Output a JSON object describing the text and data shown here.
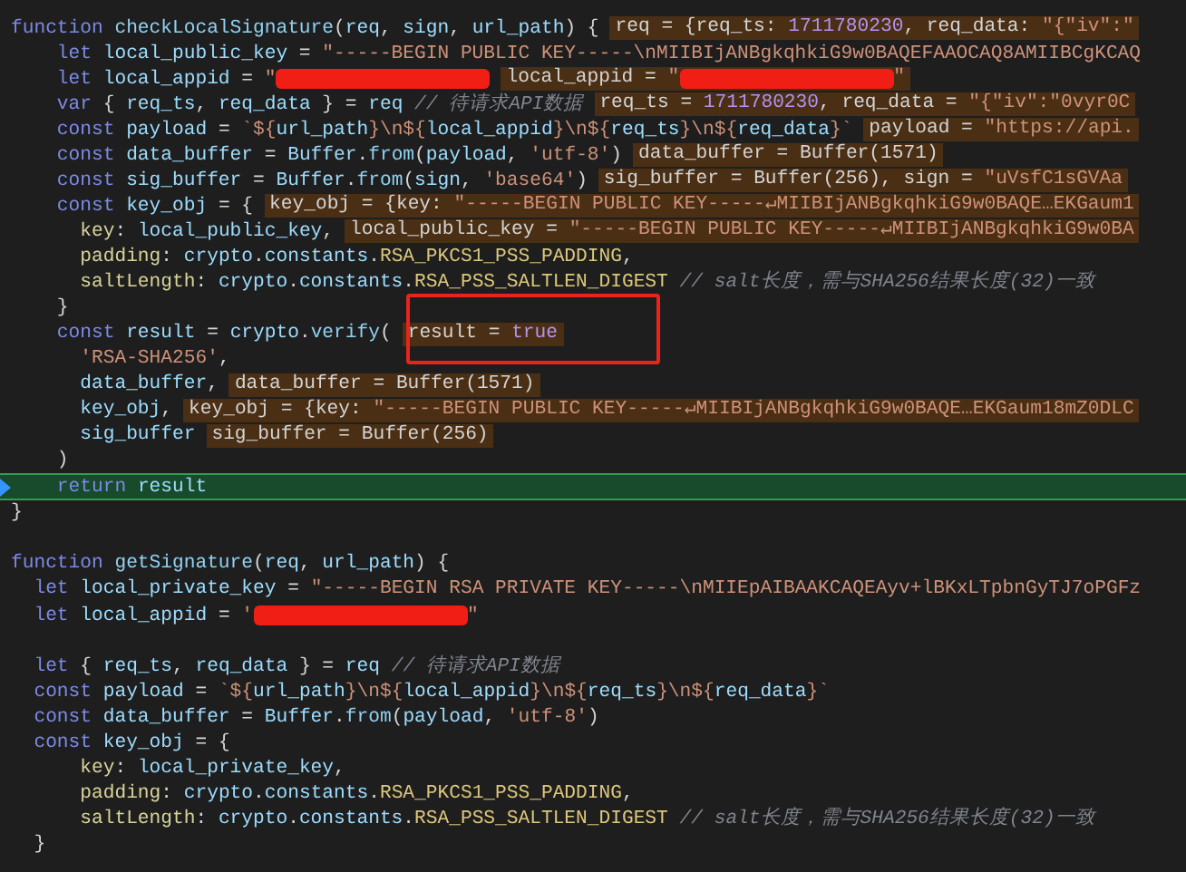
{
  "editor": {
    "lines": [
      {
        "kind": "code",
        "segs": [
          {
            "kind": "kw",
            "text": "function "
          },
          {
            "kind": "fn",
            "text": "checkLocalSignature"
          },
          {
            "kind": "plain",
            "text": "("
          },
          {
            "kind": "var",
            "text": "req"
          },
          {
            "kind": "plain",
            "text": ", "
          },
          {
            "kind": "var",
            "text": "sign"
          },
          {
            "kind": "plain",
            "text": ", "
          },
          {
            "kind": "var",
            "text": "url_path"
          },
          {
            "kind": "plain",
            "text": ") {"
          }
        ],
        "hint": [
          {
            "kind": "plain",
            "text": "req = {req_ts: "
          },
          {
            "kind": "num",
            "text": "1711780230"
          },
          {
            "kind": "plain",
            "text": ", req_data: "
          },
          {
            "kind": "str",
            "text": "\"{\"iv\":\""
          }
        ]
      },
      {
        "kind": "code",
        "segs": [
          {
            "kind": "kw",
            "text": "    let "
          },
          {
            "kind": "var",
            "text": "local_public_key"
          },
          {
            "kind": "plain",
            "text": " = "
          },
          {
            "kind": "str",
            "text": "\"-----BEGIN PUBLIC KEY-----\\nMIIBIjANBgkqhkiG9w0BAQEFAAOCAQ8AMIIBCgKCAQ"
          }
        ]
      },
      {
        "kind": "code",
        "segs": [
          {
            "kind": "kw",
            "text": "    let "
          },
          {
            "kind": "var",
            "text": "local_appid"
          },
          {
            "kind": "plain",
            "text": " = "
          },
          {
            "kind": "str",
            "text": "\""
          },
          {
            "kind": "redact"
          }
        ],
        "hint": [
          {
            "kind": "plain",
            "text": "local_appid = "
          },
          {
            "kind": "str",
            "text": "\""
          },
          {
            "kind": "redact"
          },
          {
            "kind": "str",
            "text": "\""
          }
        ]
      },
      {
        "kind": "code",
        "segs": [
          {
            "kind": "kw",
            "text": "    var "
          },
          {
            "kind": "plain",
            "text": "{ "
          },
          {
            "kind": "var",
            "text": "req_ts"
          },
          {
            "kind": "plain",
            "text": ", "
          },
          {
            "kind": "var",
            "text": "req_data"
          },
          {
            "kind": "plain",
            "text": " } = "
          },
          {
            "kind": "var",
            "text": "req"
          },
          {
            "kind": "cmt",
            "text": " // 待请求API数据"
          }
        ],
        "hint": [
          {
            "kind": "plain",
            "text": "req_ts = "
          },
          {
            "kind": "num",
            "text": "1711780230"
          },
          {
            "kind": "plain",
            "text": ", req_data = "
          },
          {
            "kind": "str",
            "text": "\"{\"iv\":\"0vyr0C"
          }
        ]
      },
      {
        "kind": "code",
        "segs": [
          {
            "kind": "kw",
            "text": "    const "
          },
          {
            "kind": "var",
            "text": "payload"
          },
          {
            "kind": "plain",
            "text": " = "
          },
          {
            "kind": "str",
            "text": "`${"
          },
          {
            "kind": "var",
            "text": "url_path"
          },
          {
            "kind": "str",
            "text": "}\\n${"
          },
          {
            "kind": "var",
            "text": "local_appid"
          },
          {
            "kind": "str",
            "text": "}\\n${"
          },
          {
            "kind": "var",
            "text": "req_ts"
          },
          {
            "kind": "str",
            "text": "}\\n${"
          },
          {
            "kind": "var",
            "text": "req_data"
          },
          {
            "kind": "str",
            "text": "}`"
          }
        ],
        "hint": [
          {
            "kind": "plain",
            "text": "payload = "
          },
          {
            "kind": "str",
            "text": "\"https://api."
          }
        ]
      },
      {
        "kind": "code",
        "segs": [
          {
            "kind": "kw",
            "text": "    const "
          },
          {
            "kind": "var",
            "text": "data_buffer"
          },
          {
            "kind": "plain",
            "text": " = "
          },
          {
            "kind": "var",
            "text": "Buffer"
          },
          {
            "kind": "plain",
            "text": "."
          },
          {
            "kind": "fn",
            "text": "from"
          },
          {
            "kind": "plain",
            "text": "("
          },
          {
            "kind": "var",
            "text": "payload"
          },
          {
            "kind": "plain",
            "text": ", "
          },
          {
            "kind": "str",
            "text": "'utf-8'"
          },
          {
            "kind": "plain",
            "text": ")"
          }
        ],
        "hint": [
          {
            "kind": "plain",
            "text": "data_buffer = Buffer(1571)"
          }
        ]
      },
      {
        "kind": "code",
        "segs": [
          {
            "kind": "kw",
            "text": "    const "
          },
          {
            "kind": "var",
            "text": "sig_buffer"
          },
          {
            "kind": "plain",
            "text": " = "
          },
          {
            "kind": "var",
            "text": "Buffer"
          },
          {
            "kind": "plain",
            "text": "."
          },
          {
            "kind": "fn",
            "text": "from"
          },
          {
            "kind": "plain",
            "text": "("
          },
          {
            "kind": "var",
            "text": "sign"
          },
          {
            "kind": "plain",
            "text": ", "
          },
          {
            "kind": "str",
            "text": "'base64'"
          },
          {
            "kind": "plain",
            "text": ")"
          }
        ],
        "hint": [
          {
            "kind": "plain",
            "text": "sig_buffer = Buffer(256), sign = "
          },
          {
            "kind": "str",
            "text": "\"uVsfC1sGVAa"
          }
        ]
      },
      {
        "kind": "code",
        "segs": [
          {
            "kind": "kw",
            "text": "    const "
          },
          {
            "kind": "var",
            "text": "key_obj"
          },
          {
            "kind": "plain",
            "text": " = {"
          }
        ],
        "hint": [
          {
            "kind": "plain",
            "text": "key_obj = {key: "
          },
          {
            "kind": "str",
            "text": "\"-----BEGIN PUBLIC KEY-----↵MIIBIjANBgkqhkiG9w0BAQE…EKGaum1"
          }
        ]
      },
      {
        "kind": "code",
        "segs": [
          {
            "kind": "prop",
            "text": "      key"
          },
          {
            "kind": "plain",
            "text": ": "
          },
          {
            "kind": "var",
            "text": "local_public_key"
          },
          {
            "kind": "plain",
            "text": ","
          }
        ],
        "hint": [
          {
            "kind": "plain",
            "text": "local_public_key = "
          },
          {
            "kind": "str",
            "text": "\"-----BEGIN PUBLIC KEY-----↵MIIBIjANBgkqhkiG9w0BA"
          }
        ]
      },
      {
        "kind": "code",
        "segs": [
          {
            "kind": "prop",
            "text": "      padding"
          },
          {
            "kind": "plain",
            "text": ": "
          },
          {
            "kind": "var",
            "text": "crypto"
          },
          {
            "kind": "plain",
            "text": "."
          },
          {
            "kind": "var",
            "text": "constants"
          },
          {
            "kind": "plain",
            "text": "."
          },
          {
            "kind": "const",
            "text": "RSA_PKCS1_PSS_PADDING"
          },
          {
            "kind": "plain",
            "text": ","
          }
        ]
      },
      {
        "kind": "code",
        "segs": [
          {
            "kind": "prop",
            "text": "      saltLength"
          },
          {
            "kind": "plain",
            "text": ": "
          },
          {
            "kind": "var",
            "text": "crypto"
          },
          {
            "kind": "plain",
            "text": "."
          },
          {
            "kind": "var",
            "text": "constants"
          },
          {
            "kind": "plain",
            "text": "."
          },
          {
            "kind": "const",
            "text": "RSA_PSS_SALTLEN_DIGEST"
          },
          {
            "kind": "cmt",
            "text": " // salt长度，需与SHA256结果长度(32)一致"
          }
        ]
      },
      {
        "kind": "code",
        "segs": [
          {
            "kind": "plain",
            "text": "    }"
          }
        ]
      },
      {
        "kind": "code",
        "segs": [
          {
            "kind": "kw",
            "text": "    const "
          },
          {
            "kind": "var",
            "text": "result"
          },
          {
            "kind": "plain",
            "text": " = "
          },
          {
            "kind": "var",
            "text": "crypto"
          },
          {
            "kind": "plain",
            "text": "."
          },
          {
            "kind": "fn",
            "text": "verify"
          },
          {
            "kind": "plain",
            "text": "("
          }
        ],
        "hint": [
          {
            "kind": "plain",
            "text": "result = "
          },
          {
            "kind": "num",
            "text": "true"
          }
        ]
      },
      {
        "kind": "code",
        "segs": [
          {
            "kind": "str",
            "text": "      'RSA-SHA256'"
          },
          {
            "kind": "plain",
            "text": ","
          }
        ]
      },
      {
        "kind": "code",
        "segs": [
          {
            "kind": "var",
            "text": "      data_buffer"
          },
          {
            "kind": "plain",
            "text": ","
          }
        ],
        "hint": [
          {
            "kind": "plain",
            "text": "data_buffer = Buffer(1571)"
          }
        ]
      },
      {
        "kind": "code",
        "segs": [
          {
            "kind": "var",
            "text": "      key_obj"
          },
          {
            "kind": "plain",
            "text": ","
          }
        ],
        "hint": [
          {
            "kind": "plain",
            "text": "key_obj = {key: "
          },
          {
            "kind": "str",
            "text": "\"-----BEGIN PUBLIC KEY-----↵MIIBIjANBgkqhkiG9w0BAQE…EKGaum18mZ0DLC"
          }
        ]
      },
      {
        "kind": "code",
        "segs": [
          {
            "kind": "var",
            "text": "      sig_buffer"
          }
        ],
        "hint": [
          {
            "kind": "plain",
            "text": "sig_buffer = Buffer(256)"
          }
        ]
      },
      {
        "kind": "code",
        "segs": [
          {
            "kind": "plain",
            "text": "    )"
          }
        ]
      },
      {
        "kind": "code",
        "current": true,
        "segs": [
          {
            "kind": "kw",
            "text": "    return "
          },
          {
            "kind": "var",
            "text": "result"
          }
        ]
      },
      {
        "kind": "code",
        "segs": [
          {
            "kind": "plain",
            "text": "}"
          }
        ]
      },
      {
        "kind": "blank"
      },
      {
        "kind": "code",
        "segs": [
          {
            "kind": "kw",
            "text": "function "
          },
          {
            "kind": "fn",
            "text": "getSignature"
          },
          {
            "kind": "plain",
            "text": "("
          },
          {
            "kind": "var",
            "text": "req"
          },
          {
            "kind": "plain",
            "text": ", "
          },
          {
            "kind": "var",
            "text": "url_path"
          },
          {
            "kind": "plain",
            "text": ") {"
          }
        ]
      },
      {
        "kind": "code",
        "segs": [
          {
            "kind": "kw",
            "text": "  let "
          },
          {
            "kind": "var",
            "text": "local_private_key"
          },
          {
            "kind": "plain",
            "text": " = "
          },
          {
            "kind": "str",
            "text": "\"-----BEGIN RSA PRIVATE KEY-----\\nMIIEpAIBAAKCAQEAyv+lBKxLTpbnGyTJ7oPGFz"
          }
        ]
      },
      {
        "kind": "code",
        "segs": [
          {
            "kind": "kw",
            "text": "  let "
          },
          {
            "kind": "var",
            "text": "local_appid"
          },
          {
            "kind": "plain",
            "text": " = "
          },
          {
            "kind": "str",
            "text": "'"
          },
          {
            "kind": "redact"
          },
          {
            "kind": "str",
            "text": "\""
          }
        ]
      },
      {
        "kind": "blank"
      },
      {
        "kind": "code",
        "segs": [
          {
            "kind": "kw",
            "text": "  let "
          },
          {
            "kind": "plain",
            "text": "{ "
          },
          {
            "kind": "var",
            "text": "req_ts"
          },
          {
            "kind": "plain",
            "text": ", "
          },
          {
            "kind": "var",
            "text": "req_data"
          },
          {
            "kind": "plain",
            "text": " } = "
          },
          {
            "kind": "var",
            "text": "req"
          },
          {
            "kind": "cmt",
            "text": " // 待请求API数据"
          }
        ]
      },
      {
        "kind": "code",
        "segs": [
          {
            "kind": "kw",
            "text": "  const "
          },
          {
            "kind": "var",
            "text": "payload"
          },
          {
            "kind": "plain",
            "text": " = "
          },
          {
            "kind": "str",
            "text": "`${"
          },
          {
            "kind": "var",
            "text": "url_path"
          },
          {
            "kind": "str",
            "text": "}\\n${"
          },
          {
            "kind": "var",
            "text": "local_appid"
          },
          {
            "kind": "str",
            "text": "}\\n${"
          },
          {
            "kind": "var",
            "text": "req_ts"
          },
          {
            "kind": "str",
            "text": "}\\n${"
          },
          {
            "kind": "var",
            "text": "req_data"
          },
          {
            "kind": "str",
            "text": "}`"
          }
        ]
      },
      {
        "kind": "code",
        "segs": [
          {
            "kind": "kw",
            "text": "  const "
          },
          {
            "kind": "var",
            "text": "data_buffer"
          },
          {
            "kind": "plain",
            "text": " = "
          },
          {
            "kind": "var",
            "text": "Buffer"
          },
          {
            "kind": "plain",
            "text": "."
          },
          {
            "kind": "fn",
            "text": "from"
          },
          {
            "kind": "plain",
            "text": "("
          },
          {
            "kind": "var",
            "text": "payload"
          },
          {
            "kind": "plain",
            "text": ", "
          },
          {
            "kind": "str",
            "text": "'utf-8'"
          },
          {
            "kind": "plain",
            "text": ")"
          }
        ]
      },
      {
        "kind": "code",
        "segs": [
          {
            "kind": "kw",
            "text": "  const "
          },
          {
            "kind": "var",
            "text": "key_obj"
          },
          {
            "kind": "plain",
            "text": " = {"
          }
        ]
      },
      {
        "kind": "code",
        "segs": [
          {
            "kind": "prop",
            "text": "      key"
          },
          {
            "kind": "plain",
            "text": ": "
          },
          {
            "kind": "var",
            "text": "local_private_key"
          },
          {
            "kind": "plain",
            "text": ","
          }
        ]
      },
      {
        "kind": "code",
        "segs": [
          {
            "kind": "prop",
            "text": "      padding"
          },
          {
            "kind": "plain",
            "text": ": "
          },
          {
            "kind": "var",
            "text": "crypto"
          },
          {
            "kind": "plain",
            "text": "."
          },
          {
            "kind": "var",
            "text": "constants"
          },
          {
            "kind": "plain",
            "text": "."
          },
          {
            "kind": "const",
            "text": "RSA_PKCS1_PSS_PADDING"
          },
          {
            "kind": "plain",
            "text": ","
          }
        ]
      },
      {
        "kind": "code",
        "segs": [
          {
            "kind": "prop",
            "text": "      saltLength"
          },
          {
            "kind": "plain",
            "text": ": "
          },
          {
            "kind": "var",
            "text": "crypto"
          },
          {
            "kind": "plain",
            "text": "."
          },
          {
            "kind": "var",
            "text": "constants"
          },
          {
            "kind": "plain",
            "text": "."
          },
          {
            "kind": "const",
            "text": "RSA_PSS_SALTLEN_DIGEST"
          },
          {
            "kind": "cmt",
            "text": " // salt长度，需与SHA256结果长度(32)一致"
          }
        ]
      },
      {
        "kind": "code",
        "segs": [
          {
            "kind": "plain",
            "text": "  }"
          }
        ]
      }
    ]
  }
}
